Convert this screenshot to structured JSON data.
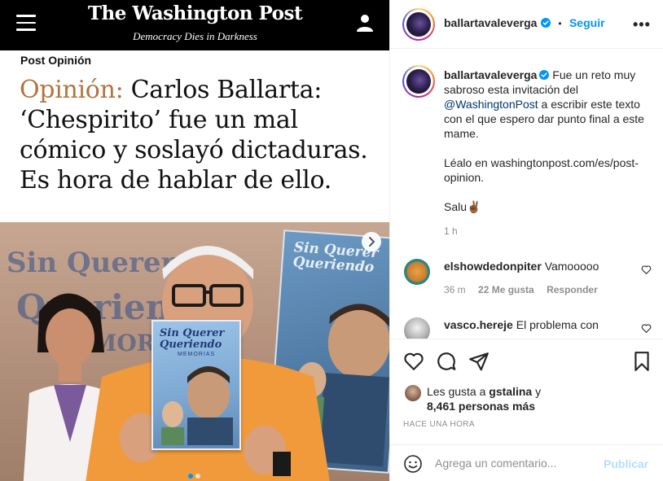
{
  "post_image": {
    "masthead": "The Washington Post",
    "tagline": "Democracy Dies in Darkness",
    "section_label": "Post Opinión",
    "headline_kicker": "Opinión:",
    "headline_rest": " Carlos Ballarta: ‘Chespirito’ fue un mal cómico y soslayó dictaduras. Es hora de hablar de ello.",
    "backdrop_text_1": "Sin Querer",
    "backdrop_text_2": "Queriendo",
    "backdrop_text_3": "MEMORIAS",
    "poster_text": "Sin Querer Queriendo",
    "book_title": "Sin Querer Queriendo",
    "book_subtitle": "MEMORIAS",
    "carousel_dots": 2,
    "active_dot": 0
  },
  "header": {
    "username": "ballartavaleverga",
    "separator": "•",
    "follow_label": "Seguir",
    "more_label": "•••"
  },
  "caption": {
    "username": "ballartavaleverga",
    "text_1": " Fue un reto muy sabroso esta invitación del ",
    "mention": "@WashingtonPost",
    "text_2": " a escribir este texto con el que espero dar punto final a este mame.",
    "text_3": "Léalo en washingtonpost.com/es/post-opinion.",
    "text_4": "Salu✌🏾",
    "time": "1 h"
  },
  "comments": [
    {
      "username": "elshowdedonpiter",
      "text": "Vamooooo",
      "time": "36 m",
      "likes": "22 Me gusta",
      "reply": "Responder"
    },
    {
      "username": "vasco.hereje",
      "text": "El problema con"
    }
  ],
  "likes": {
    "prefix": "Les gusta a ",
    "liker": "gstalina",
    "suffix": " y",
    "count": "8,461 personas más"
  },
  "timestamp": "HACE UNA HORA",
  "comment_form": {
    "placeholder": "Agrega un comentario...",
    "publish_label": "Publicar"
  },
  "colors": {
    "link_blue": "#0095f6",
    "publish_disabled": "#b2dffc",
    "kicker": "#b1743c",
    "muted": "#8e8e8e"
  }
}
